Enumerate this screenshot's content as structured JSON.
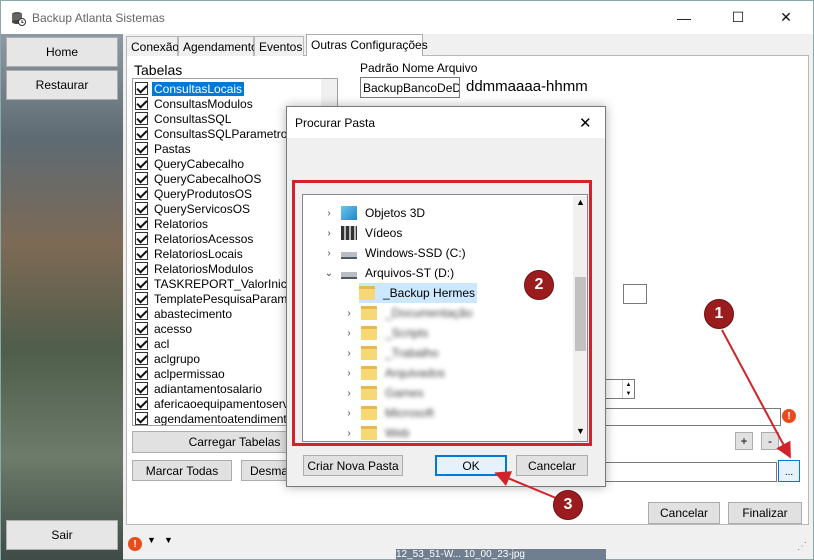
{
  "window": {
    "title": "Backup Atlanta Sistemas",
    "controls": {
      "minimize": "—",
      "maximize": "☐",
      "close": "✕"
    }
  },
  "sidebar": {
    "home": "Home",
    "restore": "Restaurar",
    "exit": "Sair"
  },
  "tabs": [
    "Conexão",
    "Agendamento",
    "Eventos",
    "Outras Configurações"
  ],
  "tables": {
    "label": "Tabelas",
    "items": [
      "ConsultasLocais",
      "ConsultasModulos",
      "ConsultasSQL",
      "ConsultasSQLParametros",
      "Pastas",
      "QueryCabecalho",
      "QueryCabecalhoOS",
      "QueryProdutosOS",
      "QueryServicosOS",
      "Relatorios",
      "RelatoriosAcessos",
      "RelatoriosLocais",
      "RelatoriosModulos",
      "TASKREPORT_ValorInicialF",
      "TemplatePesquisaParametro",
      "abastecimento",
      "acesso",
      "acl",
      "aclgrupo",
      "aclpermissao",
      "adiantamentosalario",
      "afericaoequipamentoservico",
      "agendamentoatendimento"
    ],
    "selected_index": 0
  },
  "file_name": {
    "label": "Padrão Nome Arquivo",
    "value": "BackupBancoDeDa",
    "format_hint": "ddmmaaaa-hhmm"
  },
  "buttons": {
    "carregar": "Carregar Tabelas",
    "marcar": "Marcar Todas",
    "desmarcar": "Desmarcar",
    "plus": "+",
    "minus": "-",
    "browse": "...",
    "cancelar": "Cancelar",
    "finalizar": "Finalizar"
  },
  "dialog": {
    "title": "Procurar Pasta",
    "close": "✕",
    "tree": [
      {
        "label": "Objetos 3D",
        "icon": "3d-objects-icon",
        "expander": "›",
        "level": 1
      },
      {
        "label": "Vídeos",
        "icon": "video-icon",
        "expander": "›",
        "level": 1
      },
      {
        "label": "Windows-SSD (C:)",
        "icon": "drive-icon",
        "expander": "›",
        "level": 1
      },
      {
        "label": "Arquivos-ST (D:)",
        "icon": "drive-icon",
        "expander": "⌄",
        "level": 1
      },
      {
        "label": "_Backup Hermes",
        "icon": "folder-icon",
        "expander": "",
        "level": 2,
        "selected": true
      },
      {
        "label": "_Documentação",
        "icon": "folder-icon",
        "expander": "›",
        "level": 2,
        "blurred": true
      },
      {
        "label": "_Scripts",
        "icon": "folder-icon",
        "expander": "›",
        "level": 2,
        "blurred": true
      },
      {
        "label": "_Trabalho",
        "icon": "folder-icon",
        "expander": "›",
        "level": 2,
        "blurred": true
      },
      {
        "label": "Arquivados",
        "icon": "folder-icon",
        "expander": "›",
        "level": 2,
        "blurred": true
      },
      {
        "label": "Games",
        "icon": "folder-icon",
        "expander": "›",
        "level": 2,
        "blurred": true
      },
      {
        "label": "Microsoft",
        "icon": "folder-icon",
        "expander": "›",
        "level": 2,
        "blurred": true
      },
      {
        "label": "Web",
        "icon": "folder-icon",
        "expander": "›",
        "level": 2,
        "blurred": true
      }
    ],
    "buttons": {
      "criar": "Criar Nova Pasta",
      "ok": "OK",
      "cancelar": "Cancelar"
    }
  },
  "annotations": {
    "markers": [
      "1",
      "2",
      "3"
    ],
    "color": "#d2232a"
  },
  "taskbar_text": "12_53_51-W... 10_00_23-jpg",
  "colors": {
    "selection": "#0078d7",
    "tree_selection": "#cce8ff",
    "warning": "#e74c1c"
  }
}
